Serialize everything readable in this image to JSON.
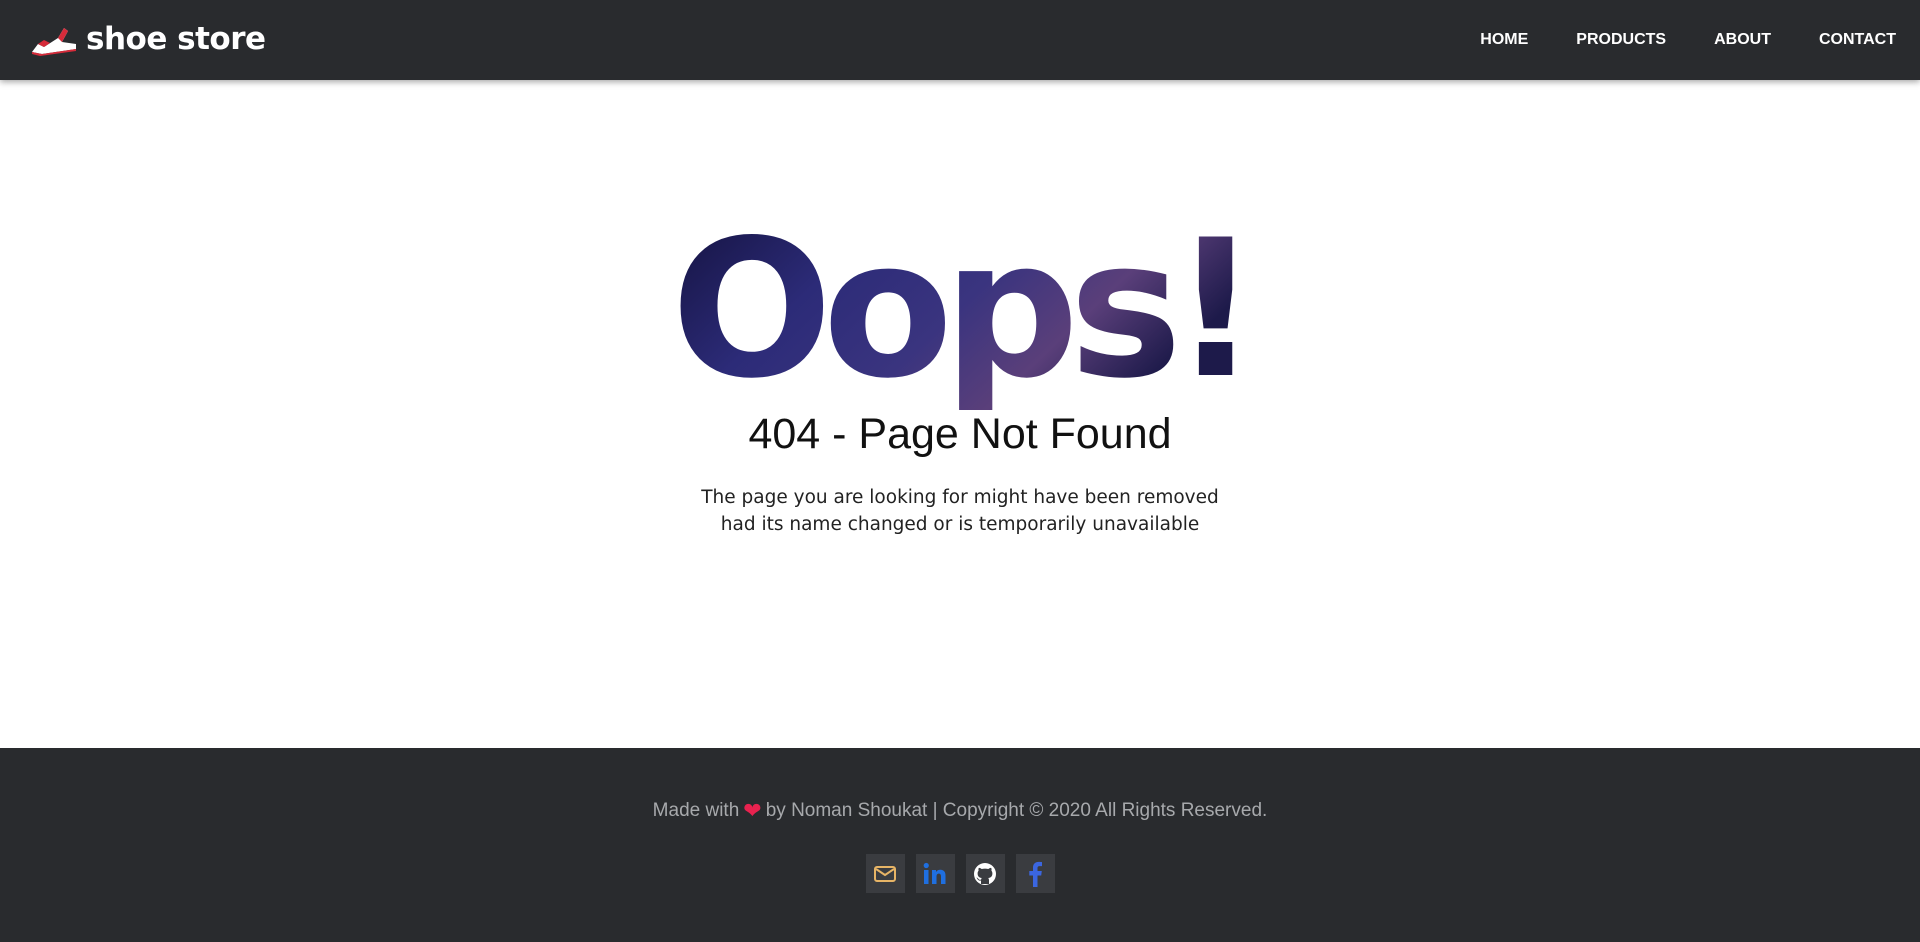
{
  "brand": {
    "name": "shoe store",
    "logo_icon": "sneaker-icon"
  },
  "nav": {
    "items": [
      {
        "label": "HOME"
      },
      {
        "label": "PRODUCTS"
      },
      {
        "label": "ABOUT"
      },
      {
        "label": "CONTACT"
      }
    ]
  },
  "error": {
    "headline": "Oops!",
    "title": "404 - Page Not Found",
    "description_line1": "The page you are looking for might have been removed",
    "description_line2": "had its name changed or is temporarily unavailable"
  },
  "footer": {
    "made_with": "Made with",
    "heart_icon": "heart-icon",
    "credit": "by Noman Shoukat | Copyright © 2020 All Rights Reserved.",
    "social": [
      {
        "icon": "envelope-icon",
        "color": "#e6b466"
      },
      {
        "icon": "linkedin-icon",
        "color": "#1f6fe0"
      },
      {
        "icon": "github-icon",
        "color": "#ffffff"
      },
      {
        "icon": "facebook-icon",
        "color": "#3b66e0"
      }
    ]
  },
  "colors": {
    "header_bg": "#292b2e",
    "footer_bg": "#292b2e",
    "heart": "#e8224f",
    "oops_fill": "#2d2a6e"
  }
}
